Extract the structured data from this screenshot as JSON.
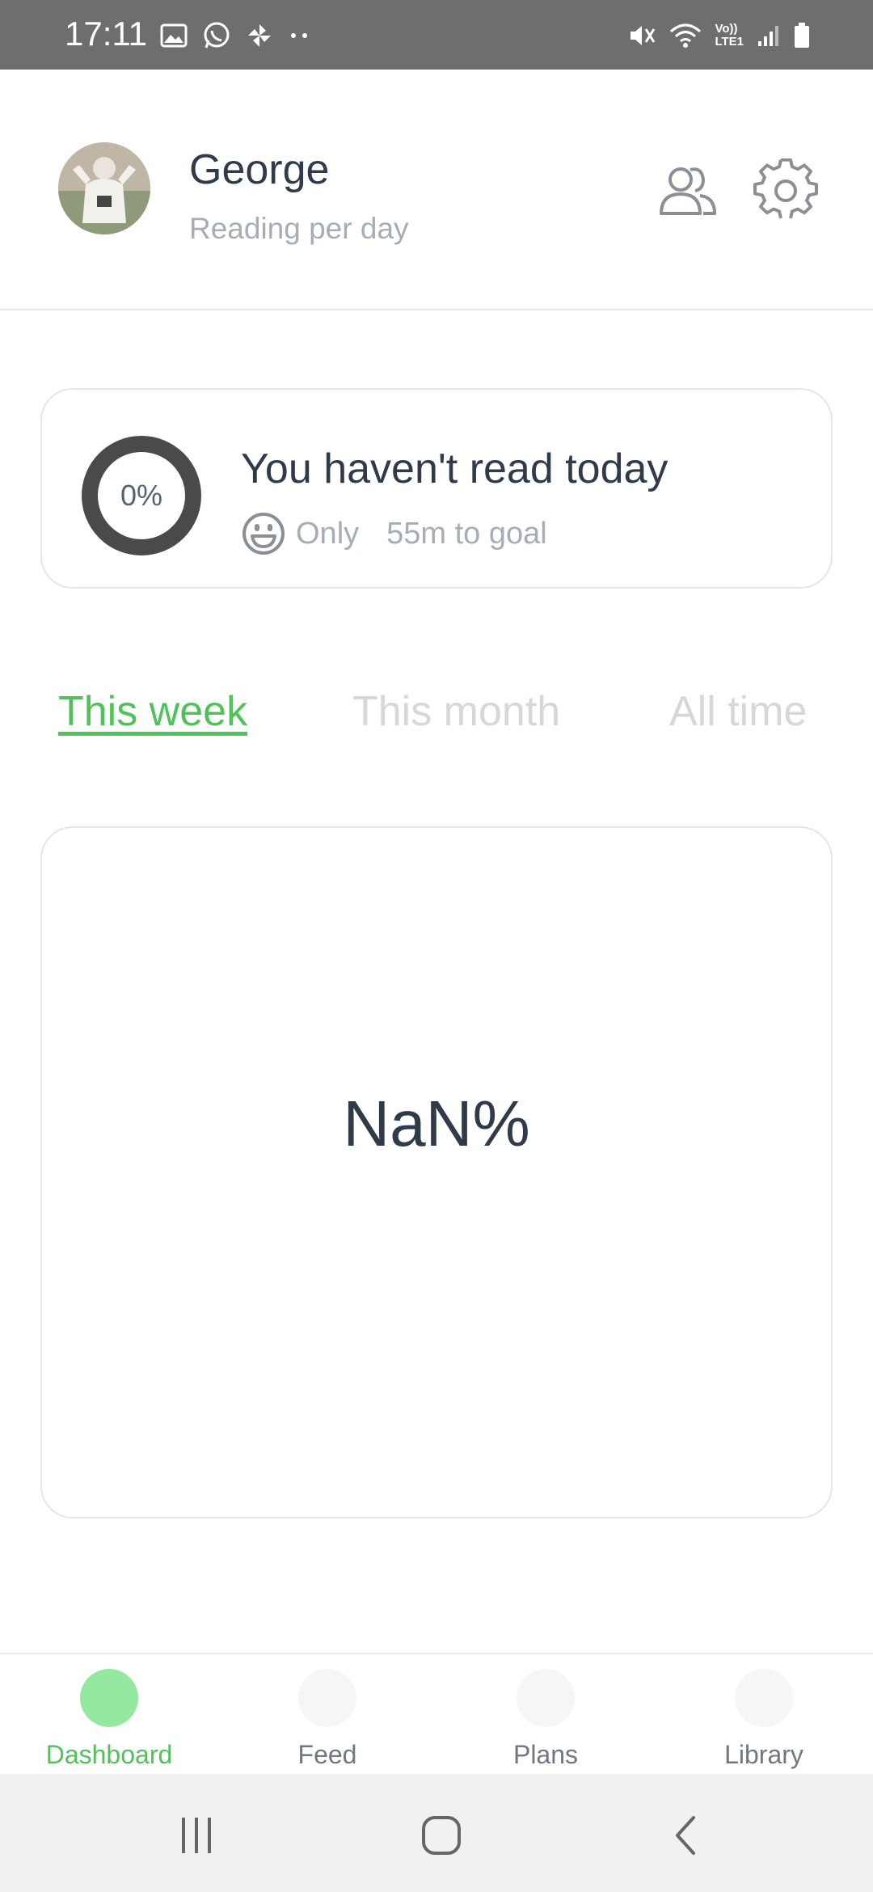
{
  "status_bar": {
    "time": "17:11",
    "left_icons": [
      "gallery-icon",
      "whatsapp-icon",
      "pinwheel-icon",
      "more-dots-icon"
    ],
    "right_icons": [
      "mute-icon",
      "wifi-icon",
      "volte-icon",
      "signal-icon",
      "battery-icon"
    ],
    "volte_text_top": "Vo))",
    "volte_text_bottom": "LTE1"
  },
  "header": {
    "user_name": "George",
    "subtitle": "Reading per day",
    "actions": [
      "friends-icon",
      "gear-icon"
    ]
  },
  "today": {
    "progress_label": "0%",
    "progress": 0,
    "title": "You haven't read today",
    "sub_prefix": "Only",
    "sub_goal": "55m to goal",
    "icon": "smile-icon"
  },
  "tabs": [
    {
      "label": "This week",
      "active": true
    },
    {
      "label": "This month",
      "active": false
    },
    {
      "label": "All time",
      "active": false
    }
  ],
  "stats": {
    "value": "NaN%"
  },
  "bottom_nav": [
    {
      "label": "Dashboard",
      "active": true
    },
    {
      "label": "Feed",
      "active": false
    },
    {
      "label": "Plans",
      "active": false
    },
    {
      "label": "Library",
      "active": false
    }
  ],
  "system_nav": [
    "recents-icon",
    "home-icon",
    "back-icon"
  ],
  "colors": {
    "accent": "#51c25a",
    "accent_light": "#95e8a0",
    "text_dark": "#2f3b4b",
    "text_muted": "#a6adb6",
    "ring": "#4a4a4a"
  }
}
